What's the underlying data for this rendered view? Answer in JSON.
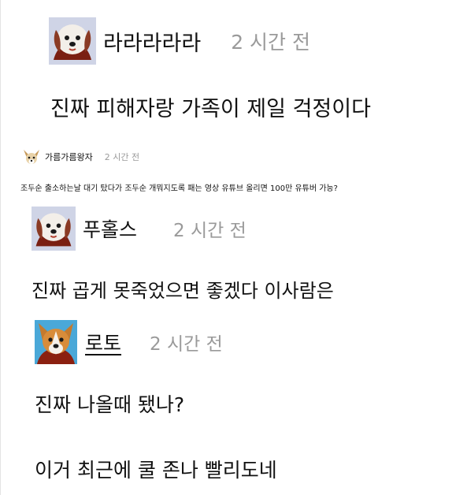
{
  "comments": [
    {
      "author": "라라라라라",
      "time": "2 시간 전",
      "text": "진짜 피해자랑 가족이 제일 걱정이다",
      "avatar_icon": "puppy-avatar-icon"
    },
    {
      "author": "가름가름왕자",
      "time": "2 시간 전",
      "text": "조두순 출소하는날 대기 탔다가 조두순 개뭐지도록 패는 영상 유튜브 올리면 100만 유튜버 가능?",
      "avatar_icon": "chihuahua-avatar-icon"
    },
    {
      "author": "푸홀스",
      "time": "2 시간 전",
      "text": "진짜 곱게 못죽었으면 좋겠다 이사람은",
      "avatar_icon": "puppy-avatar-icon"
    },
    {
      "author": "로토",
      "time": "2 시간 전",
      "text": "진짜 나올때 됐나?",
      "avatar_icon": "corgi-avatar-icon"
    },
    {
      "text": "이거 최근에 쿨 존나 빨리도네"
    }
  ],
  "colors": {
    "text": "#111111",
    "time": "#9a9a9a",
    "background": "#ffffff"
  }
}
